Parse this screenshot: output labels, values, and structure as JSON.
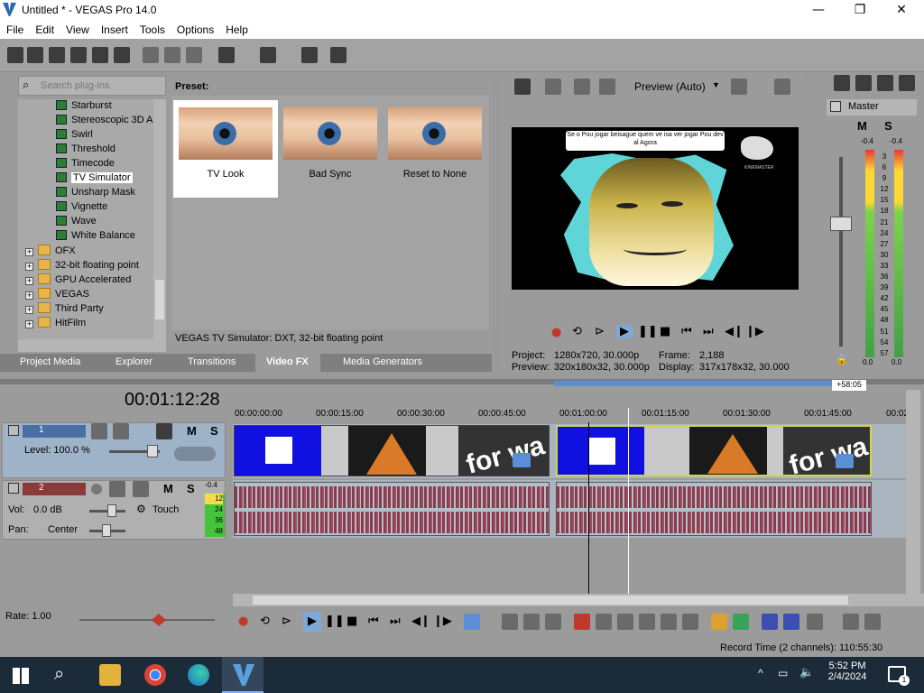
{
  "window": {
    "title": "Untitled * - VEGAS Pro 14.0",
    "minimize": "—",
    "maximize": "❐",
    "close": "✕"
  },
  "menu": [
    "File",
    "Edit",
    "View",
    "Insert",
    "Tools",
    "Options",
    "Help"
  ],
  "plugins": {
    "search_placeholder": "Search plug-ins",
    "fx_items": [
      "Starburst",
      "Stereoscopic 3D A",
      "Swirl",
      "Threshold",
      "Timecode",
      "TV Simulator",
      "Unsharp Mask",
      "Vignette",
      "Wave",
      "White Balance"
    ],
    "selected": "TV Simulator",
    "folders": [
      "OFX",
      "32-bit floating point",
      "GPU Accelerated",
      "VEGAS",
      "Third Party",
      "HitFilm"
    ],
    "preset_label": "Preset:",
    "presets": [
      "TV Look",
      "Bad Sync",
      "Reset to None"
    ],
    "description": "VEGAS TV Simulator: DXT, 32-bit floating point"
  },
  "tabs": [
    "Project Media",
    "Explorer",
    "Transitions",
    "Video FX",
    "Media Generators"
  ],
  "active_tab": "Video FX",
  "preview": {
    "mode": "Preview (Auto)",
    "overlay_text": "Se o Pou jogar beisague quem ve isa ver jogar Pou dev al Agora",
    "watermark": "KINEMASTER",
    "project_label": "Project:",
    "project_value": "1280x720, 30.000p",
    "frame_label": "Frame:",
    "frame_value": "2,188",
    "preview_label": "Preview:",
    "preview_value": "320x180x32, 30.000p",
    "display_label": "Display:",
    "display_value": "317x178x32, 30.000"
  },
  "master": {
    "label": "Master",
    "peak_left": "-0.4",
    "peak_right": "-0.4",
    "scale": [
      "3",
      "6",
      "9",
      "12",
      "15",
      "18",
      "21",
      "24",
      "27",
      "30",
      "33",
      "36",
      "39",
      "42",
      "45",
      "48",
      "51",
      "54",
      "57"
    ],
    "bottom_left": "0.0",
    "bottom_right": "0.0"
  },
  "timeline": {
    "timecode": "00:01:12:28",
    "offset_badge": "+58:05",
    "ruler": [
      "00:00:00:00",
      "00:00:15:00",
      "00:00:30:00",
      "00:00:45:00",
      "00:01:00:00",
      "00:01:15:00",
      "00:01:30:00",
      "00:01:45:00",
      "00:02"
    ],
    "clip_overlay_text": "for wa"
  },
  "track1": {
    "number": "1",
    "level_label": "Level: 100.0 %"
  },
  "track2": {
    "number": "2",
    "vol_label": "Vol:",
    "vol_value": "0.0 dB",
    "automation": "Touch",
    "pan_label": "Pan:",
    "pan_value": "Center",
    "peak": "-0.4",
    "meter_ticks": [
      "12",
      "24",
      "36",
      "48"
    ]
  },
  "rate": "Rate: 1.00",
  "status": {
    "record_time": "Record Time (2 channels): 110:55:30"
  },
  "taskbar": {
    "time": "5:52 PM",
    "date": "2/4/2024",
    "notif_count": "1"
  },
  "colors": {
    "video_clip_blue": "#1010e0",
    "audio_wave": "#8b3a4d",
    "meter_green": "#43a047"
  }
}
